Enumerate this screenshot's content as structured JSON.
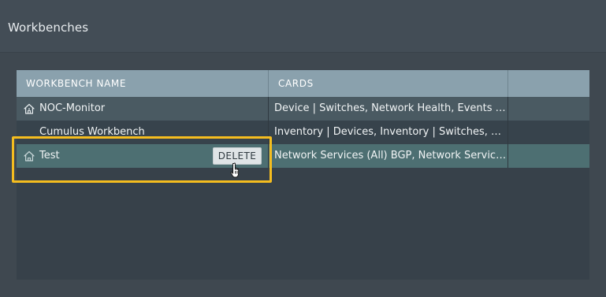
{
  "page": {
    "title": "Workbenches"
  },
  "table": {
    "columns": [
      "WORKBENCH NAME",
      "CARDS"
    ],
    "rows": [
      {
        "name": "NOC-Monitor",
        "cards": "Device | Switches, Network Health, Events | Alarms, Events | Info, Inventory | Devices",
        "icon": "home-icon",
        "is_home": true
      },
      {
        "name": "Cumulus Workbench",
        "cards": "Inventory | Devices, Inventory | Switches, Events | Alarms",
        "icon": "",
        "is_home": false
      },
      {
        "name": "Test",
        "cards": "Network Services (All) BGP, Network Services (All) EVPN",
        "icon": "home-icon",
        "is_home": false,
        "selected": true,
        "action_label": "DELETE"
      }
    ]
  },
  "colors": {
    "background": "#3f4850",
    "header_row": "#8aa1ad",
    "selected_row": "#4d6f72",
    "highlight": "#f5bd1f"
  }
}
